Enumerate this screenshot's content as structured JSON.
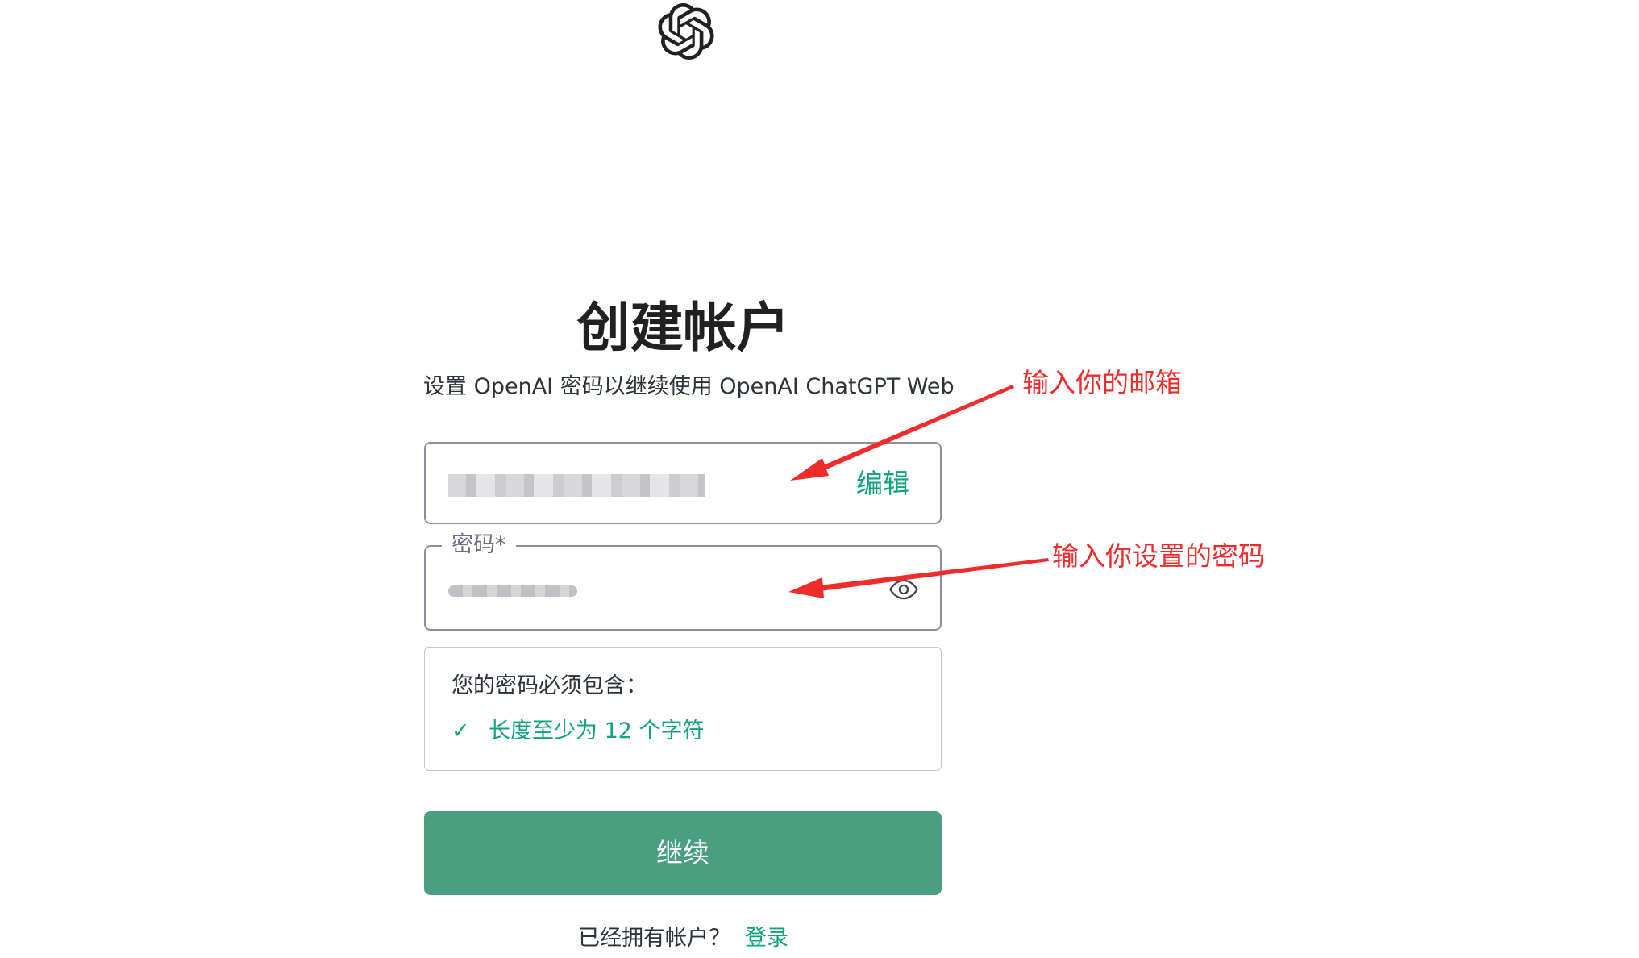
{
  "logo": {
    "icon": "openai-logo-icon"
  },
  "header": {
    "title": "创建帐户",
    "subtitle": "设置 OpenAI 密码以继续使用 OpenAI ChatGPT Web"
  },
  "email": {
    "edit_label": "编辑"
  },
  "password": {
    "label": "密码*",
    "toggle_icon": "eye-icon"
  },
  "requirements": {
    "title": "您的密码必须包含：",
    "items": [
      {
        "check": "✓",
        "text": "长度至少为 12 个字符"
      }
    ]
  },
  "continue_button": "继续",
  "footer": {
    "prompt": "已经拥有帐户？",
    "login_link": "登录"
  },
  "annotations": [
    {
      "text": "输入你的邮箱"
    },
    {
      "text": "输入你设置的密码"
    }
  ],
  "colors": {
    "brand_green": "#10a37f",
    "button_green": "#4a9f80",
    "annotation_red": "#ef2b2b"
  }
}
